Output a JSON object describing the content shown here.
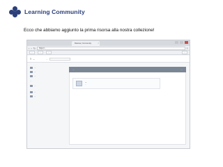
{
  "header": {
    "brand": "Learning Community",
    "caption": "Ecco che abbiamo aggiunto la prima risorsa alla nostra collezione!"
  },
  "browser": {
    "tab_label": "Risorsa | Community",
    "url": "https://...",
    "bookmarks": [
      "...",
      "...",
      "..."
    ],
    "bookmarks_other": "..."
  },
  "app": {
    "appbar": {
      "logo": "...",
      "search_label": "...",
      "search_placeholder": "..."
    },
    "sidebar": {
      "items": [
        {
          "label": "..."
        },
        {
          "label": "..."
        },
        {
          "label": "..."
        }
      ],
      "section_label": "...",
      "collection_label": "...",
      "extra": [
        {
          "label": "..."
        },
        {
          "label": "..."
        }
      ]
    },
    "panel": {
      "title": "...",
      "action": "...",
      "resource": {
        "title": "...",
        "description": "..."
      }
    }
  },
  "colors": {
    "brand": "#2b3f7a",
    "panel_header": "#7b8695"
  }
}
